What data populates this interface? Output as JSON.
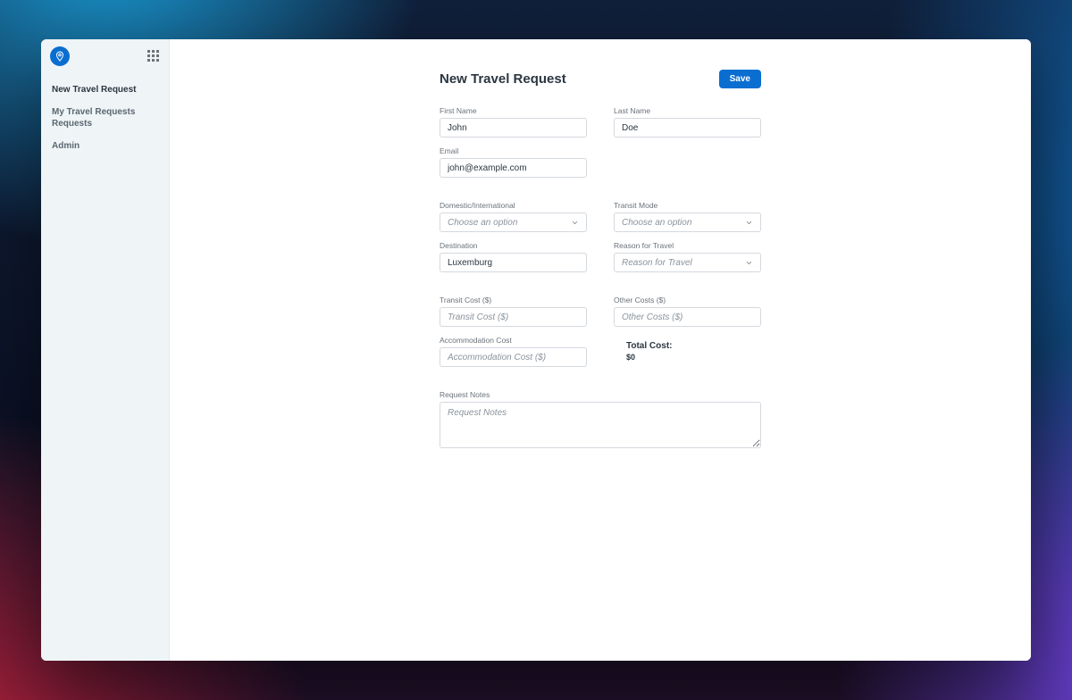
{
  "sidebar": {
    "items": [
      {
        "label": "New Travel Request",
        "active": true
      },
      {
        "label": "My Travel Requests Requests",
        "active": false
      },
      {
        "label": "Admin",
        "active": false
      }
    ]
  },
  "header": {
    "title": "New Travel Request",
    "save_label": "Save"
  },
  "form": {
    "first_name": {
      "label": "First Name",
      "value": "John"
    },
    "last_name": {
      "label": "Last Name",
      "value": "Doe"
    },
    "email": {
      "label": "Email",
      "value": "john@example.com"
    },
    "dom_intl": {
      "label": "Domestic/International",
      "placeholder": "Choose an option"
    },
    "transit_mode": {
      "label": "Transit Mode",
      "placeholder": "Choose an option"
    },
    "destination": {
      "label": "Destination",
      "value": "Luxemburg"
    },
    "reason": {
      "label": "Reason for Travel",
      "placeholder": "Reason for Travel"
    },
    "transit_cost": {
      "label": "Transit Cost ($)",
      "placeholder": "Transit Cost ($)"
    },
    "other_costs": {
      "label": "Other Costs ($)",
      "placeholder": "Other Costs ($)"
    },
    "accom_cost": {
      "label": "Accommodation Cost",
      "placeholder": "Accommodation Cost ($)"
    },
    "total": {
      "label": "Total Cost:",
      "value": "$0"
    },
    "notes": {
      "label": "Request Notes",
      "placeholder": "Request Notes"
    }
  }
}
